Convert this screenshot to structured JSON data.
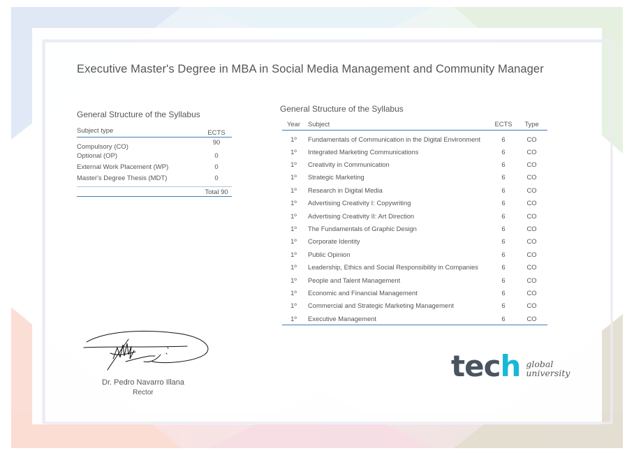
{
  "document": {
    "title": "Executive Master's Degree in MBA in Social Media Management and Community Manager"
  },
  "summary": {
    "heading": "General Structure of the Syllabus",
    "col_type": "Subject type",
    "col_ects": "ECTS",
    "rows": [
      {
        "type": "Compulsory (CO)",
        "ects": "90"
      },
      {
        "type": "Optional (OP)",
        "ects": "0"
      },
      {
        "type": "External Work Placement (WP)",
        "ects": "0"
      },
      {
        "type": "Master's Degree Thesis (MDT)",
        "ects": "0"
      }
    ],
    "total": "Total 90"
  },
  "syllabus": {
    "heading": "General Structure of the Syllabus",
    "columns": {
      "year": "Year",
      "subject": "Subject",
      "ects": "ECTS",
      "type": "Type"
    },
    "rows": [
      {
        "year": "1º",
        "subject": "Fundamentals of Communication in the Digital Environment",
        "ects": "6",
        "type": "CO"
      },
      {
        "year": "1º",
        "subject": "Integrated Marketing Communications",
        "ects": "6",
        "type": "CO"
      },
      {
        "year": "1º",
        "subject": "Creativity in Communication",
        "ects": "6",
        "type": "CO"
      },
      {
        "year": "1º",
        "subject": "Strategic Marketing",
        "ects": "6",
        "type": "CO"
      },
      {
        "year": "1º",
        "subject": "Research in Digital Media",
        "ects": "6",
        "type": "CO"
      },
      {
        "year": "1º",
        "subject": "Advertising Creativity I: Copywriting",
        "ects": "6",
        "type": "CO"
      },
      {
        "year": "1º",
        "subject": "Advertising Creativity II: Art Direction",
        "ects": "6",
        "type": "CO"
      },
      {
        "year": "1º",
        "subject": "The Fundamentals of Graphic Design",
        "ects": "6",
        "type": "CO"
      },
      {
        "year": "1º",
        "subject": "Corporate Identity",
        "ects": "6",
        "type": "CO"
      },
      {
        "year": "1º",
        "subject": "Public Opinion",
        "ects": "6",
        "type": "CO"
      },
      {
        "year": "1º",
        "subject": "Leadership, Ethics and Social Responsibility in Companies",
        "ects": "6",
        "type": "CO"
      },
      {
        "year": "1º",
        "subject": "People and Talent Management",
        "ects": "6",
        "type": "CO"
      },
      {
        "year": "1º",
        "subject": "Economic and Financial Management",
        "ects": "6",
        "type": "CO"
      },
      {
        "year": "1º",
        "subject": "Commercial and  Strategic Marketing Management",
        "ects": "6",
        "type": "CO"
      },
      {
        "year": "1º",
        "subject": "Executive Management",
        "ects": "6",
        "type": "CO"
      }
    ]
  },
  "signature": {
    "name": "Dr. Pedro Navarro Illana",
    "role": "Rector"
  },
  "logo": {
    "word_main": "tec",
    "word_accent": "h",
    "sub_line1": "global",
    "sub_line2": "university"
  },
  "colors": {
    "rule_blue": "#3f7cb6",
    "logo_gray": "#4a5360",
    "logo_cyan": "#16b8d8"
  }
}
